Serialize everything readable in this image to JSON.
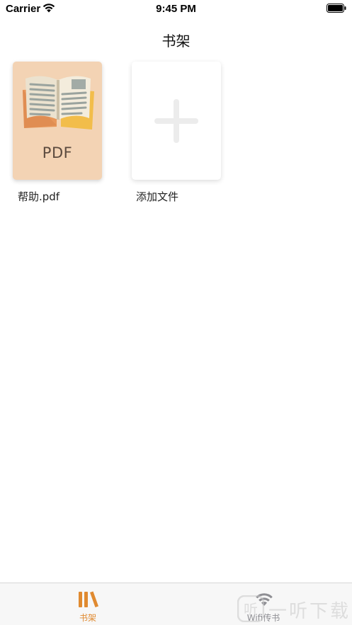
{
  "status_bar": {
    "carrier": "Carrier",
    "time": "9:45 PM"
  },
  "nav": {
    "title": "书架"
  },
  "shelf": {
    "items": [
      {
        "name": "帮助.pdf",
        "badge": "PDF",
        "cover_color": "#f3d3b4"
      },
      {
        "name": "添加文件",
        "icon": "plus-icon"
      }
    ]
  },
  "tab_bar": {
    "tabs": [
      {
        "label": "书架",
        "icon": "bookshelf-icon",
        "active": true
      },
      {
        "label": "Wifi传书",
        "icon": "wifi-icon",
        "active": false
      }
    ],
    "active_color": "#e08a30",
    "inactive_color": "#8e8e93"
  },
  "watermark": {
    "text": "一听下载",
    "logo_text": "听"
  }
}
